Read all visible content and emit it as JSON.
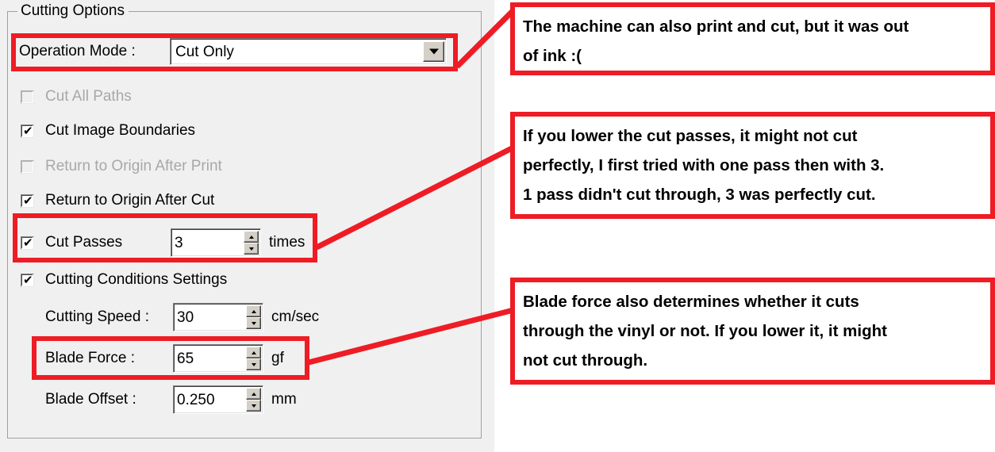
{
  "dialog": {
    "group_title": "Cutting Options",
    "operation_mode": {
      "label": "Operation Mode :",
      "value": "Cut Only",
      "arrow_icon": "chevron-down-icon"
    },
    "checkboxes": [
      {
        "label": "Cut All Paths",
        "checked": false,
        "enabled": false,
        "mark": "✔"
      },
      {
        "label": "Cut Image Boundaries",
        "checked": true,
        "enabled": true,
        "mark": "✔"
      },
      {
        "label": "Return to Origin After Print",
        "checked": false,
        "enabled": false,
        "mark": "✔"
      },
      {
        "label": "Return to Origin After Cut",
        "checked": true,
        "enabled": true,
        "mark": "✔"
      }
    ],
    "cut_passes": {
      "label": "Cut Passes",
      "checked": true,
      "mark": "✔",
      "value": "3",
      "unit": "times"
    },
    "cutting_conditions": {
      "label": "Cutting Conditions Settings",
      "checked": true,
      "mark": "✔"
    },
    "fields": [
      {
        "label": "Cutting Speed :",
        "value": "30",
        "unit": "cm/sec"
      },
      {
        "label": "Blade Force :",
        "value": "65",
        "unit": "gf"
      },
      {
        "label": "Blade Offset :",
        "value": "0.250",
        "unit": "mm"
      }
    ]
  },
  "annotations": {
    "accent_color": "#ee1c25",
    "notes": [
      {
        "id": "note-print-and-cut",
        "lines": [
          "The machine can also print and cut, but it was out",
          "of ink :("
        ]
      },
      {
        "id": "note-cut-passes",
        "lines": [
          "If you lower the cut passes, it might not cut",
          "perfectly, I first tried with one pass then with 3.",
          "1 pass didn't cut through, 3 was perfectly cut."
        ]
      },
      {
        "id": "note-blade-force",
        "lines": [
          "Blade force also determines whether it cuts",
          "through the vinyl or not. If you lower it, it might",
          "not cut through."
        ]
      }
    ]
  }
}
